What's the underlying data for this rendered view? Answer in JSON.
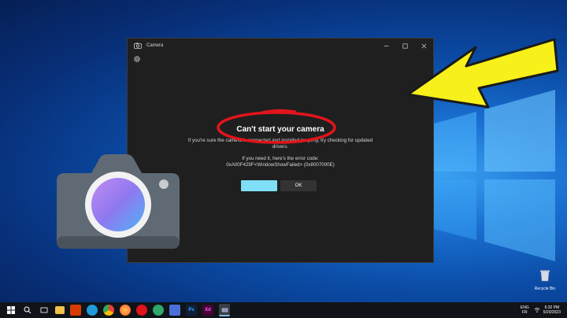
{
  "window": {
    "title": "Camera"
  },
  "dialog": {
    "heading": "Can't start your camera",
    "message": "If you're sure the camera is connected and installed properly, try checking for updated drivers.",
    "error_intro": "If you need it, here's the error code:",
    "error_code": "0xA00F429F<WindowShowFailed> (0x8007000E)",
    "primary_button_label": "",
    "ok_button_label": "OK"
  },
  "desktop": {
    "recycle_bin_label": "Recycle Bin"
  },
  "taskbar": {
    "items": [
      "start",
      "search",
      "task-view",
      "file-explorer",
      "office",
      "edge",
      "chrome",
      "firefox",
      "opera",
      "media",
      "vpn",
      "photoshop",
      "xd",
      "camera"
    ],
    "lang_top": "ENG",
    "lang_bottom": "FR",
    "time": "6:32 PM",
    "date": "5/20/2023"
  },
  "colors": {
    "accent_button": "#7fdff6",
    "annotation_circle": "#e0141c",
    "annotation_arrow": "#f7f01a"
  },
  "icons": {
    "app": "camera-icon",
    "settings": "gear-icon",
    "minimize": "minimize-icon",
    "maximize": "maximize-icon",
    "close": "close-icon"
  }
}
